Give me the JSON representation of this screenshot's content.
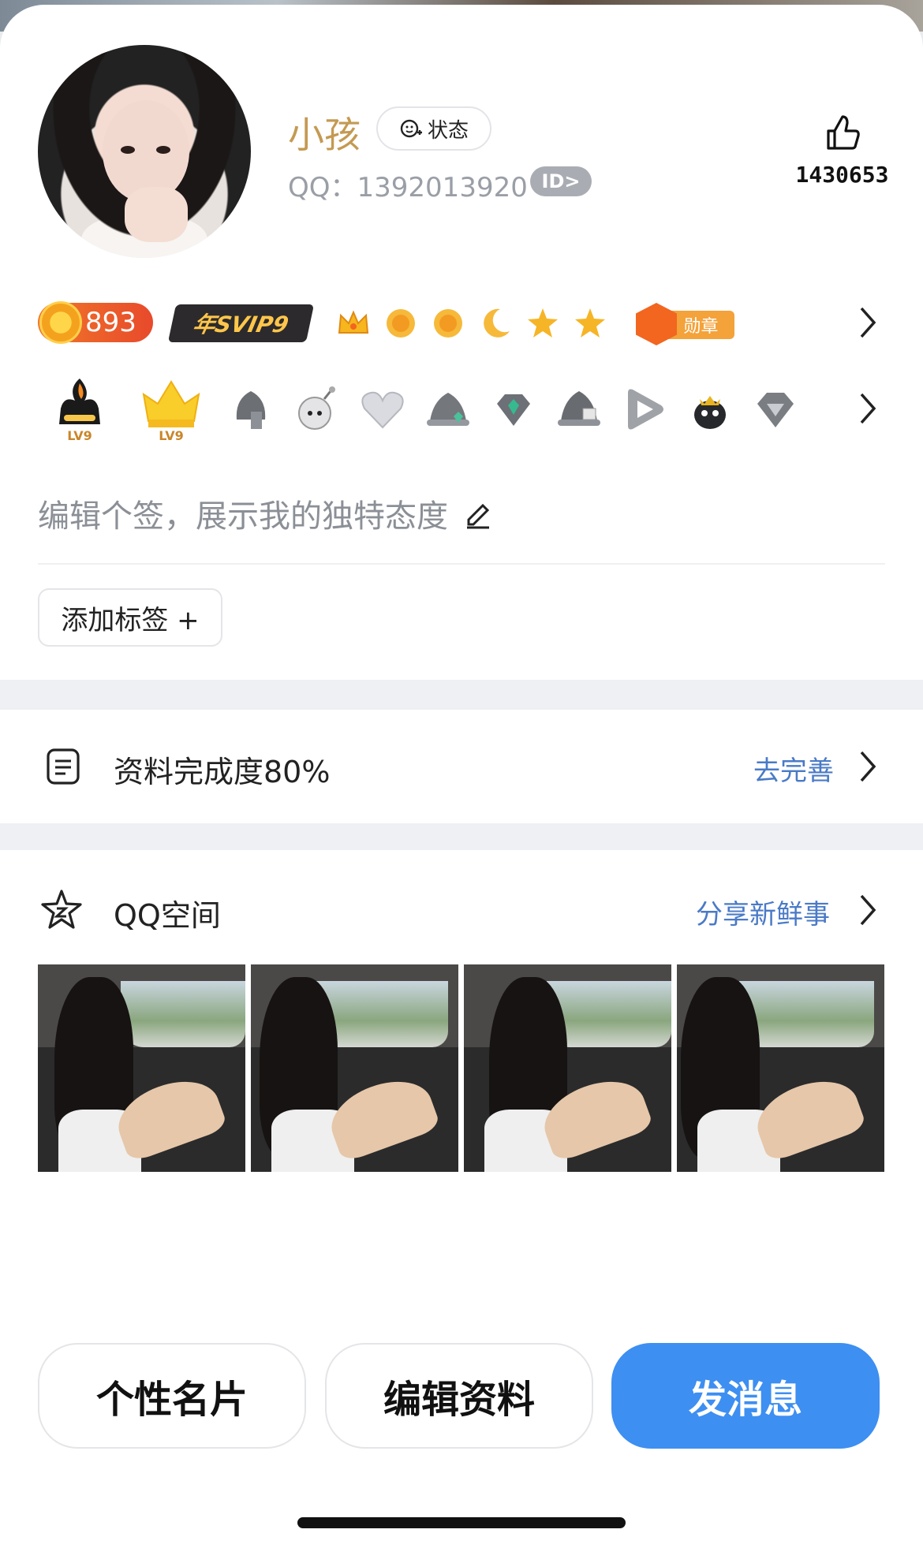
{
  "profile": {
    "nickname": "小孩",
    "status_label": "状态",
    "qq_number": "QQ：1392013920",
    "id_badge": "ID>",
    "like_count": "1430653"
  },
  "badges": {
    "coin_value": "893",
    "svip_label": "年SVIP9",
    "medal_label": "勋章",
    "level_icons": [
      "crown-icon",
      "sun-icon",
      "sun-icon",
      "moon-icon",
      "star-icon",
      "star-icon"
    ],
    "game_icons": [
      "flame-lv9-icon",
      "crown-lv9-icon",
      "helmet-icon",
      "bomb-icon",
      "heart-icon",
      "hat-gem-icon",
      "diamond-icon",
      "helmet-gift-icon",
      "play-icon",
      "penguin-crown-icon",
      "gem-icon"
    ],
    "game_level_text": "LV9"
  },
  "signature": {
    "placeholder": "编辑个签，展示我的独特态度"
  },
  "tags": {
    "add_label": "添加标签 +"
  },
  "completion": {
    "title": "资料完成度80%",
    "progress": 0.8,
    "action": "去完善"
  },
  "qzone": {
    "title": "QQ空间",
    "action": "分享新鲜事",
    "photo_count": 4
  },
  "actions": {
    "card": "个性名片",
    "edit": "编辑资料",
    "message": "发消息"
  },
  "colors": {
    "nickname": "#c49a52",
    "link": "#4a7ac7",
    "primary": "#3d8ff1"
  }
}
